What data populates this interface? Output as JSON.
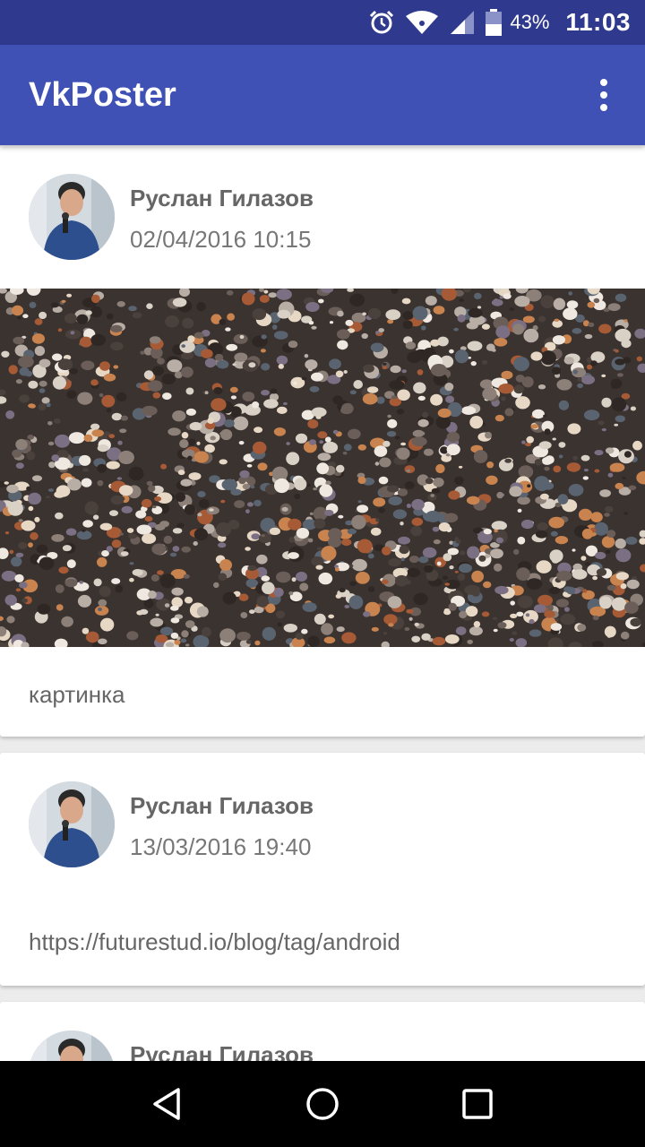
{
  "status_bar": {
    "battery_percent": "43%",
    "time": "11:03",
    "icons": [
      "alarm-icon",
      "wifi-icon",
      "signal-icon",
      "battery-icon"
    ]
  },
  "app_bar": {
    "title": "VkPoster",
    "menu_icon": "overflow-menu-icon"
  },
  "posts": [
    {
      "author": "Руслан Гилазов",
      "date": "02/04/2016 10:15",
      "has_image": true,
      "text": "картинка"
    },
    {
      "author": "Руслан Гилазов",
      "date": "13/03/2016 19:40",
      "has_image": false,
      "text": "https://futurestud.io/blog/tag/android"
    },
    {
      "author": "Руслан Гилазов",
      "date": "",
      "has_image": false,
      "text": ""
    }
  ],
  "nav_bar": {
    "icons": [
      "back-icon",
      "home-icon",
      "recents-icon"
    ]
  },
  "colors": {
    "status_bar": "#2f3a8e",
    "app_bar": "#3f51b5",
    "background": "#ececec",
    "nav_bar": "#000000"
  }
}
